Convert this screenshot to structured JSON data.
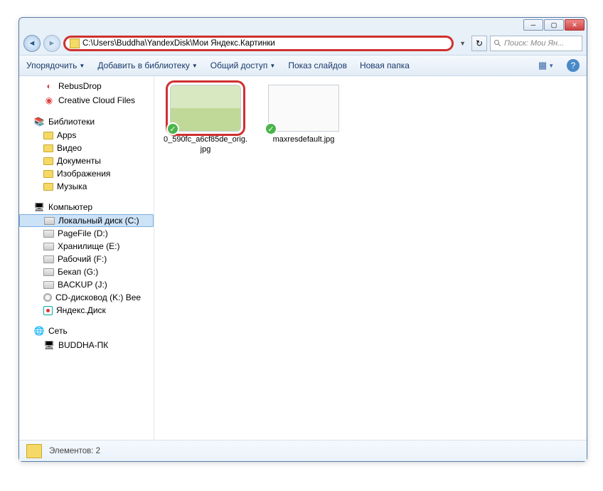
{
  "address": {
    "path": "C:\\Users\\Buddha\\YandexDisk\\Мои Яндекс.Картинки"
  },
  "search": {
    "placeholder": "Поиск: Мои Ян..."
  },
  "toolbar": {
    "organize": "Упорядочить",
    "include": "Добавить в библиотеку",
    "share": "Общий доступ",
    "slideshow": "Показ слайдов",
    "newfolder": "Новая папка"
  },
  "sidebar": {
    "items": [
      {
        "label": "RebusDrop",
        "icon": "red",
        "level": 1
      },
      {
        "label": "Creative Cloud Files",
        "icon": "cc",
        "level": 1
      }
    ],
    "libraries": {
      "header": "Библиотеки",
      "items": [
        {
          "label": "Apps"
        },
        {
          "label": "Видео"
        },
        {
          "label": "Документы"
        },
        {
          "label": "Изображения"
        },
        {
          "label": "Музыка"
        }
      ]
    },
    "computer": {
      "header": "Компьютер",
      "items": [
        {
          "label": "Локальный диск (C:)",
          "icon": "drive",
          "selected": true
        },
        {
          "label": "PageFile (D:)",
          "icon": "drive"
        },
        {
          "label": "Хранилище (E:)",
          "icon": "drive"
        },
        {
          "label": "Рабочий (F:)",
          "icon": "drive"
        },
        {
          "label": "Бекап (G:)",
          "icon": "drive"
        },
        {
          "label": "BACKUP (J:)",
          "icon": "drive"
        },
        {
          "label": "CD-дисковод (K:) Bee",
          "icon": "cd"
        },
        {
          "label": "Яндекс.Диск",
          "icon": "disk"
        }
      ]
    },
    "network": {
      "header": "Сеть",
      "items": [
        {
          "label": "BUDDHA-ПК"
        }
      ]
    }
  },
  "files": [
    {
      "name": "0_590fc_a6cf85de_orig.jpg",
      "selected": true,
      "thumb": "a"
    },
    {
      "name": "maxresdefault.jpg",
      "selected": false,
      "thumb": "b"
    }
  ],
  "statusbar": {
    "items_label": "Элементов: 2"
  }
}
